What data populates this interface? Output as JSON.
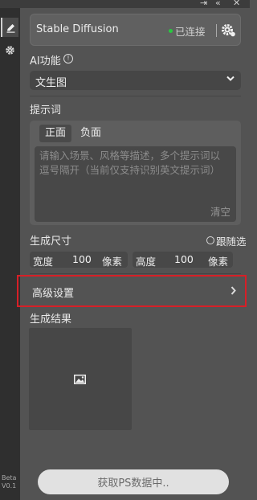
{
  "window": {
    "pin_glyph": "⇥",
    "collapse_glyph": "«",
    "close_glyph": "✕"
  },
  "rail": {
    "version_line1": "Beta",
    "version_line2": "V0.1"
  },
  "header": {
    "title": "Stable Diffusion",
    "status": "已连接",
    "status_color": "#28c840"
  },
  "ai": {
    "label": "AI功能",
    "info_glyph": "!",
    "selected": "文生图"
  },
  "prompt": {
    "label": "提示词",
    "tabs": [
      {
        "label": "正面"
      },
      {
        "label": "负面"
      }
    ],
    "placeholder": "请输入场景、风格等描述，多个提示词以逗号隔开（当前仅支持识别英文提示词）",
    "clear_label": "清空"
  },
  "size": {
    "label": "生成尺寸",
    "follow_label": "跟随选区",
    "width_label": "宽度",
    "width_value": "100",
    "height_label": "高度",
    "height_value": "100",
    "unit": "像素"
  },
  "advanced": {
    "label": "高级设置",
    "highlight_color": "#d71f27"
  },
  "result": {
    "label": "生成结果"
  },
  "footer": {
    "button_label": "获取PS数据中.."
  }
}
